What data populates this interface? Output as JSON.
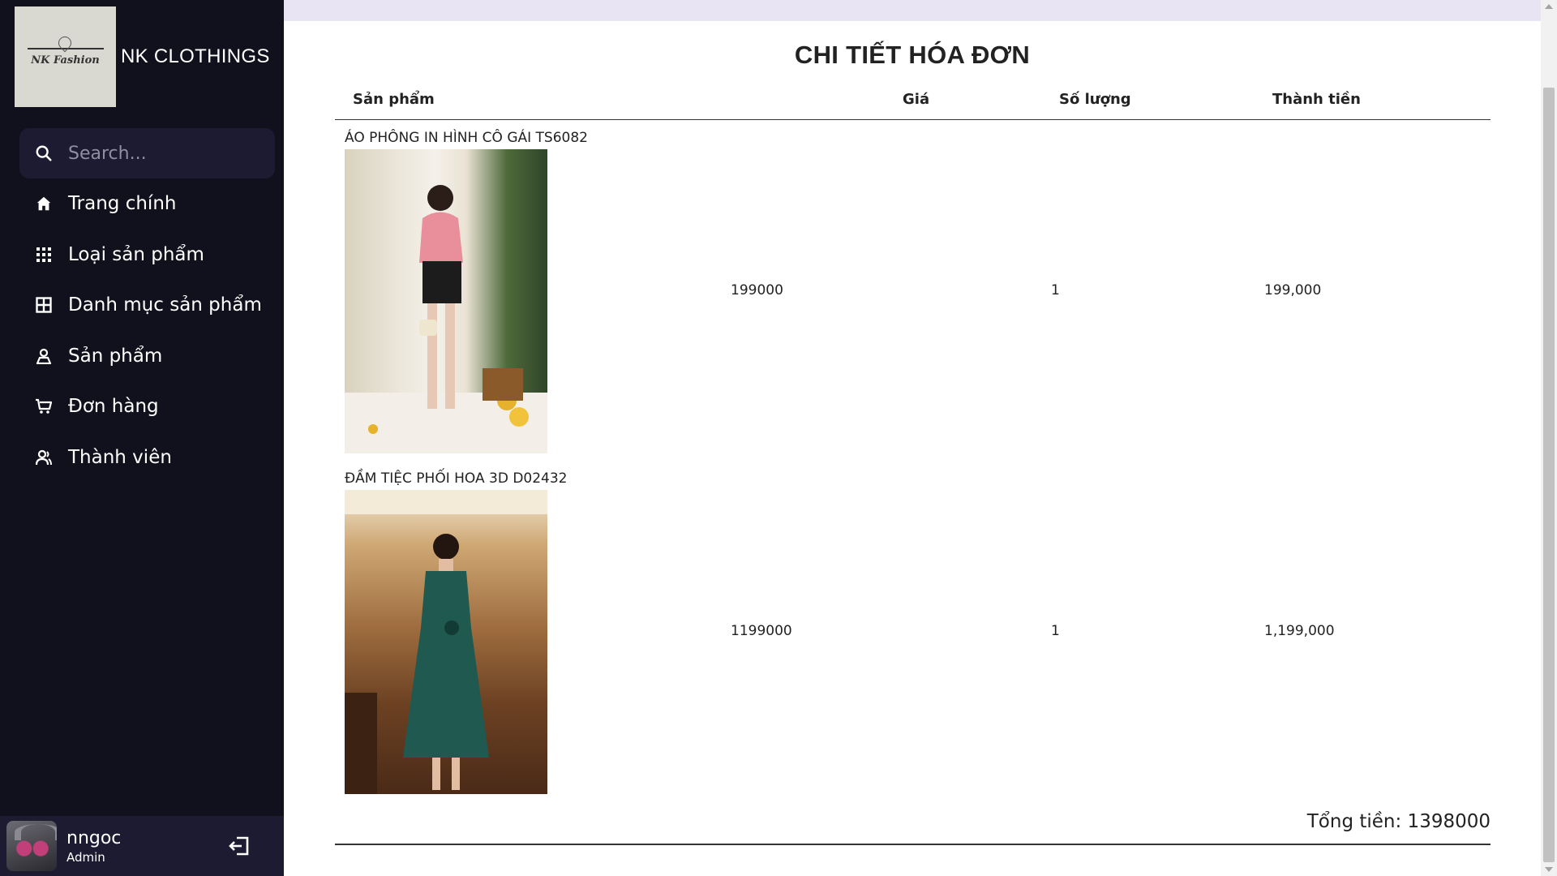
{
  "brand": {
    "logo_text": "NK Fashion",
    "name": "NK CLOTHINGS"
  },
  "search": {
    "placeholder": "Search..."
  },
  "nav": {
    "items": [
      {
        "label": "Trang chính",
        "icon": "home-icon"
      },
      {
        "label": "Loại sản phẩm",
        "icon": "grid-icon"
      },
      {
        "label": "Danh mục sản phẩm",
        "icon": "table-icon"
      },
      {
        "label": "Sản phẩm",
        "icon": "person-icon"
      },
      {
        "label": "Đơn hàng",
        "icon": "cart-icon"
      },
      {
        "label": "Thành viên",
        "icon": "users-icon"
      }
    ]
  },
  "profile": {
    "name": "nngoc",
    "role": "Admin"
  },
  "page": {
    "title": "CHI TIẾT HÓA ĐƠN"
  },
  "table": {
    "headers": [
      "Sản phẩm",
      "Giá",
      "Số lượng",
      "Thành tiền"
    ],
    "rows": [
      {
        "name": "ÁO PHÔNG IN HÌNH CÔ GÁI TS6082",
        "price": "199000",
        "qty": "1",
        "subtotal": "199,000"
      },
      {
        "name": "ĐẦM TIỆC PHỐI HOA 3D D02432",
        "price": "1199000",
        "qty": "1",
        "subtotal": "1,199,000"
      }
    ]
  },
  "total": {
    "text": "Tổng tiền: 1398000"
  },
  "colors": {
    "sidebar": "#11101d",
    "sidebar_accent": "#1d1b31",
    "topbar": "#e8e4f3"
  }
}
